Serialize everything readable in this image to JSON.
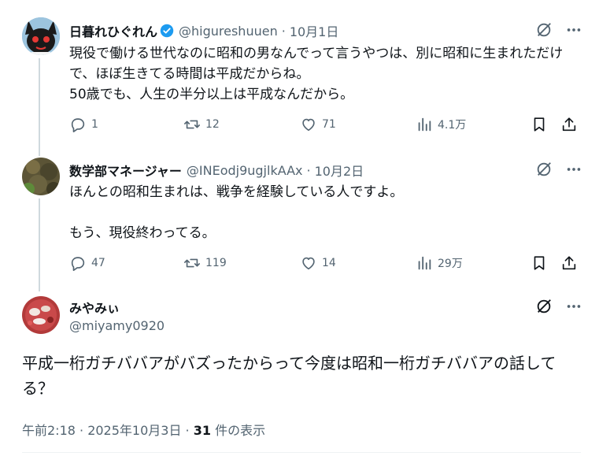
{
  "tweets": [
    {
      "name": "日暮れひぐれん",
      "handle": "@higureshuuen",
      "date": "10月1日",
      "text": "現役で働ける世代なのに昭和の男なんでって言うやつは、別に昭和に生まれただけで、ほぼ生きてる時間は平成だからね。\n50歳でも、人生の半分以上は平成なんだから。",
      "replies": "1",
      "retweets": "12",
      "likes": "71",
      "views": "4.1万",
      "verified": true
    },
    {
      "name": "数学部マネージャー",
      "handle": "@INEodj9ugjlkAAx",
      "date": "10月2日",
      "text": "ほんとの昭和生まれは、戦争を経験している人ですよ。\n\nもう、現役終わってる。",
      "replies": "47",
      "retweets": "119",
      "likes": "14",
      "views": "29万"
    }
  ],
  "main": {
    "name": "みやみぃ",
    "handle": "@miyamy0920",
    "text": "平成一桁ガチババアがバズったからって今度は昭和一桁ガチババアの話してる？",
    "time": "午前2:18 · 2025年10月3日 · ",
    "views_count": "31",
    "views_label": " 件の表示"
  },
  "colors": {
    "accent": "#1d9bf0",
    "muted": "#536471",
    "text": "#0f1419",
    "line": "#cfd9de"
  },
  "icons": [
    "reply-icon",
    "retweet-icon",
    "like-icon",
    "views-icon",
    "bookmark-icon",
    "share-icon",
    "grok-icon",
    "more-icon",
    "verified-badge-icon"
  ]
}
